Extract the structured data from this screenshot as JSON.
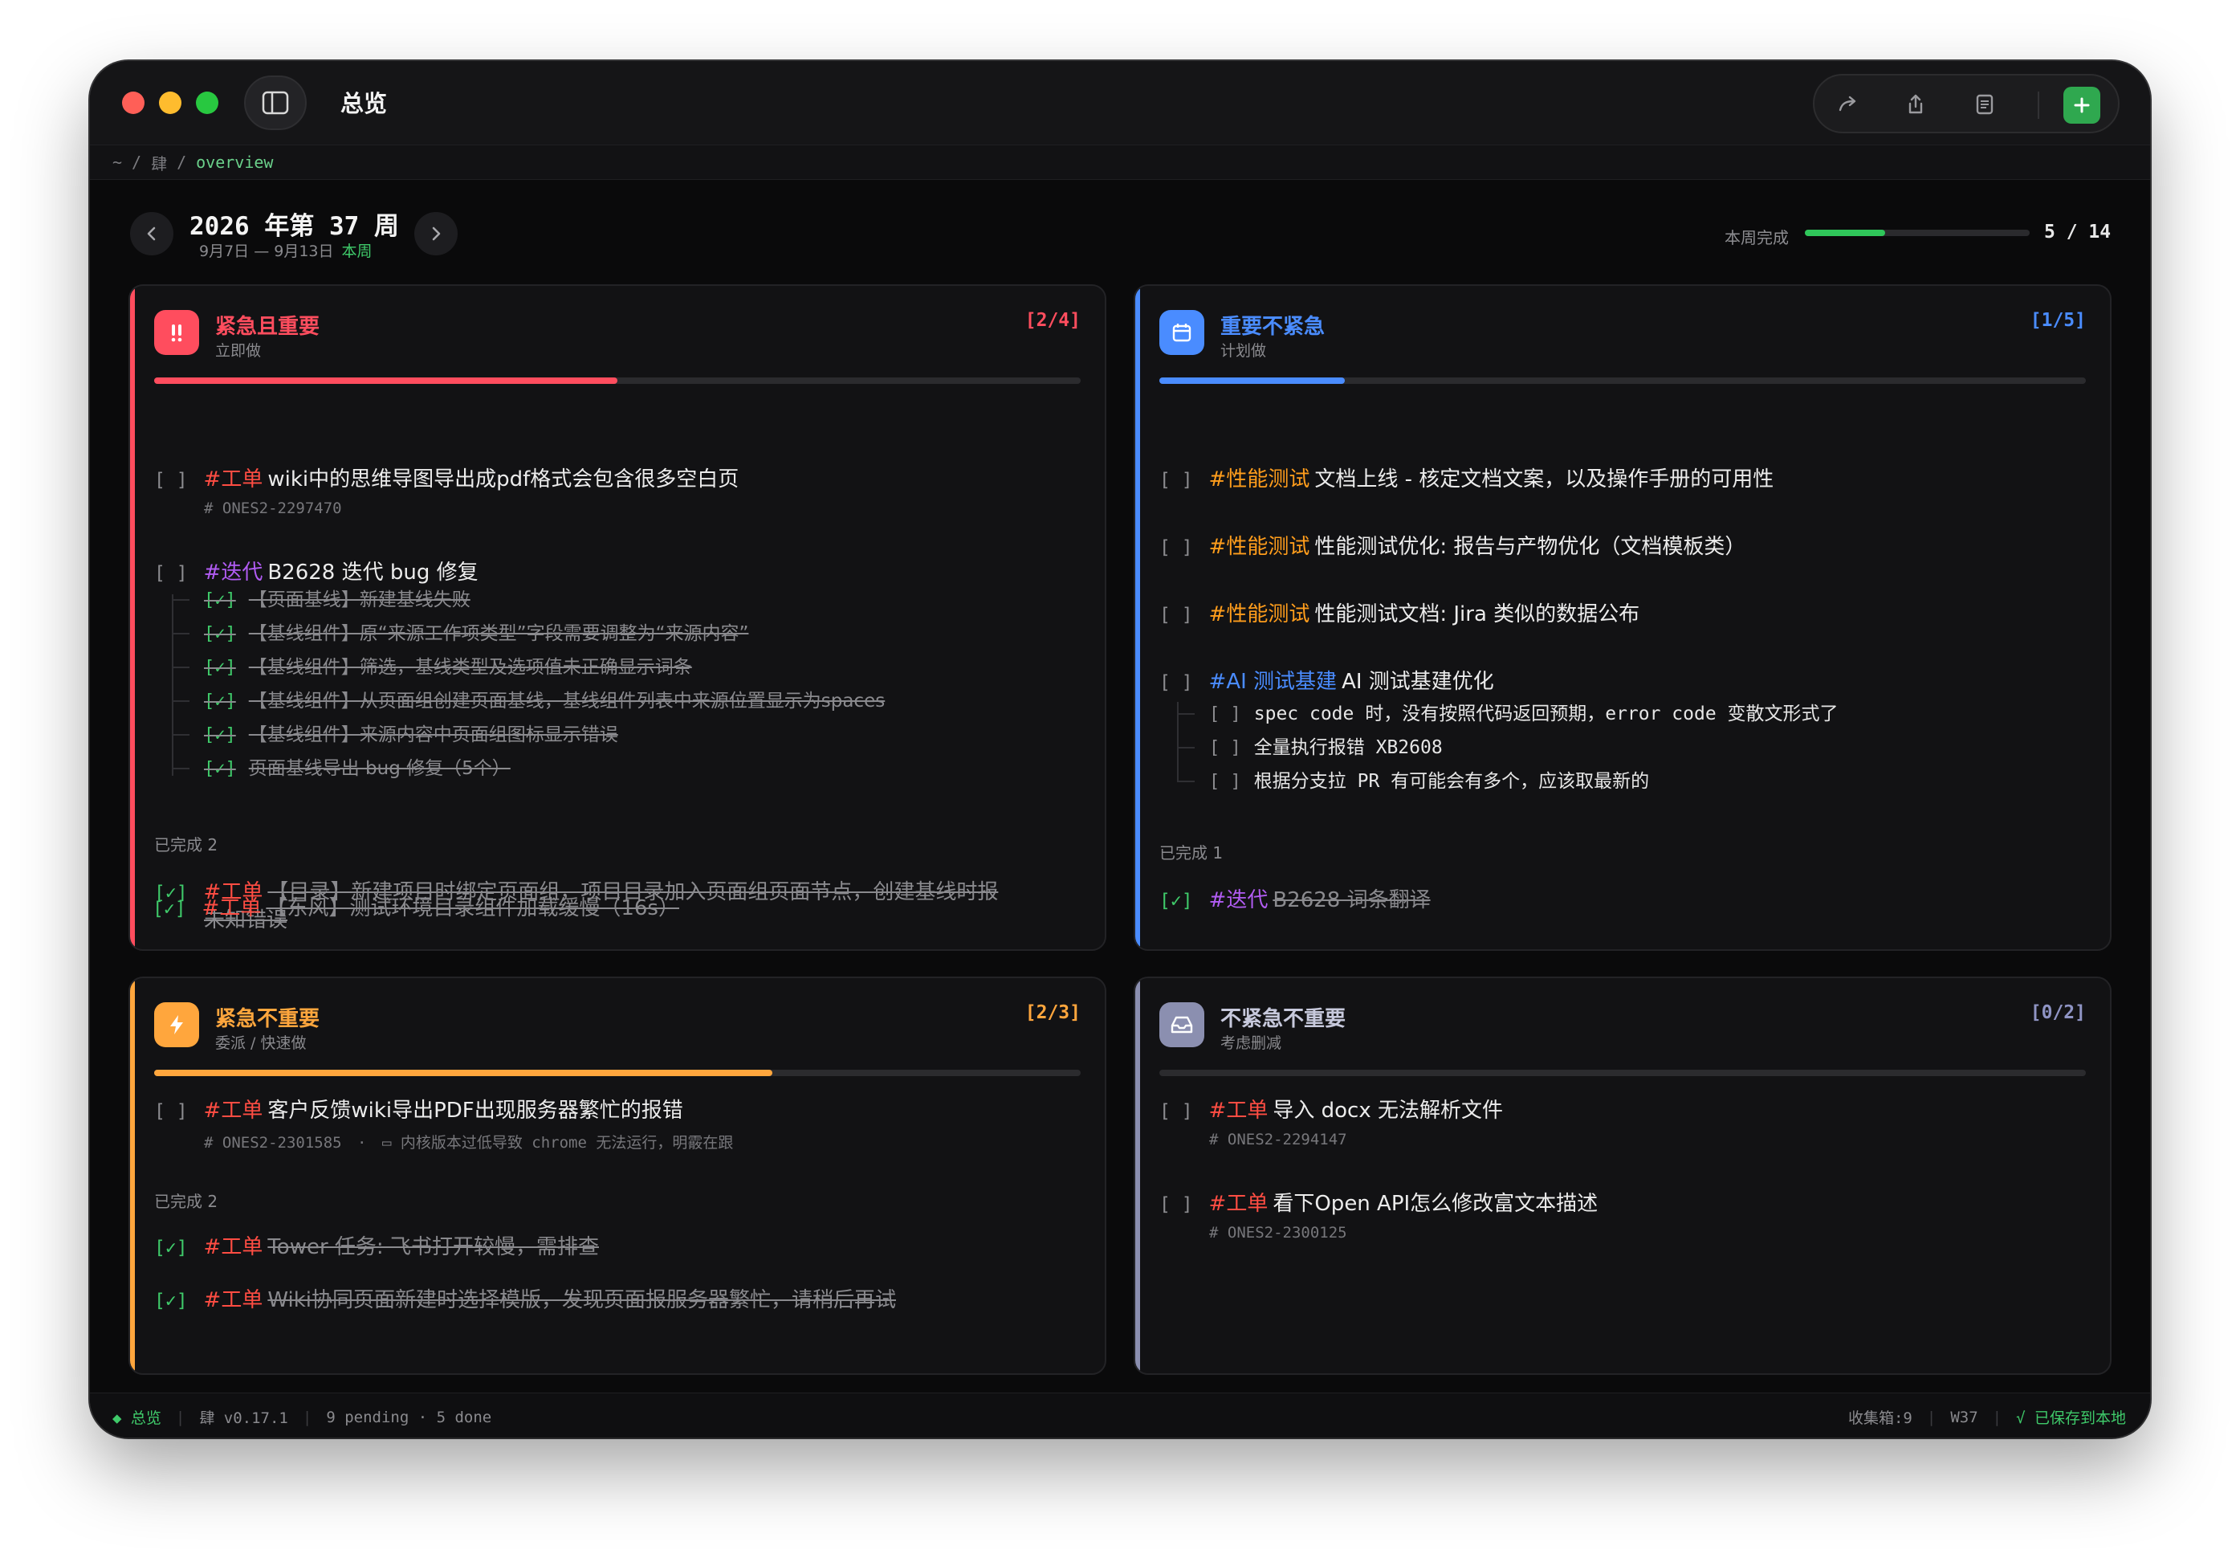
{
  "window": {
    "title": "总览",
    "traffic_lights": [
      "#ff5f57",
      "#febc2e",
      "#28c840"
    ]
  },
  "breadcrumb": {
    "home": "~",
    "sep": "/",
    "workspace": "肆",
    "current": "overview"
  },
  "week": {
    "title": "2026 年第 37 周",
    "range": "9月7日 — 9月13日",
    "tag": "本周",
    "progress_label": "本周完成",
    "progress_done": 5,
    "progress_total": 14,
    "progress_text": "5 / 14"
  },
  "quadrants": {
    "q1": {
      "title": "紧急且重要",
      "subtitle": "立即做",
      "count": "[2/4]",
      "icon": "double-exclamation-icon",
      "color": "#ff4d5e",
      "progress": 0.5,
      "pending": [
        {
          "tag": "#工单",
          "text": "wiki中的思维导图导出成pdf格式会包含很多空白页",
          "meta": "# ONES2-2297470"
        },
        {
          "tag": "#迭代",
          "text": "B2628 迭代 bug 修复",
          "subtasks": [
            "【页面基线】新建基线失败",
            "【基线组件】原“来源工作项类型”字段需要调整为“来源内容”",
            "【基线组件】筛选，基线类型及选项值未正确显示词条",
            "【基线组件】从页面组创建页面基线，基线组件列表中来源位置显示为spaces",
            "【基线组件】来源内容中页面组图标显示错误",
            "页面基线导出 bug 修复（5个）"
          ]
        }
      ],
      "done_label": "已完成 2",
      "done": [
        {
          "tag": "#工单",
          "text": "【目录】新建项目时绑定页面组，项目目录加入页面组页面节点，创建基线时报未知错误"
        },
        {
          "tag": "#工单",
          "text": "【东风】测试环境目录组件加载缓慢（16s）"
        }
      ]
    },
    "q2": {
      "title": "重要不紧急",
      "subtitle": "计划做",
      "count": "[1/5]",
      "icon": "calendar-icon",
      "color": "#4a8cff",
      "progress": 0.2,
      "pending": [
        {
          "tag": "#性能测试",
          "text": "文档上线 - 核定文档文案，以及操作手册的可用性"
        },
        {
          "tag": "#性能测试",
          "text": "性能测试优化: 报告与产物优化（文档模板类）"
        },
        {
          "tag": "#性能测试",
          "text": "性能测试文档: Jira 类似的数据公布"
        },
        {
          "tag": "#AI 测试基建",
          "text": "AI 测试基建优化",
          "subtasks": [
            "spec code 时，没有按照代码返回预期，error code 变散文形式了",
            "全量执行报错 XB2608",
            "根据分支拉 PR 有可能会有多个，应该取最新的"
          ]
        }
      ],
      "done_label": "已完成 1",
      "done": [
        {
          "tag": "#迭代",
          "text": "B2628 词条翻译"
        }
      ]
    },
    "q3": {
      "title": "紧急不重要",
      "subtitle": "委派 / 快速做",
      "count": "[2/3]",
      "icon": "lightning-icon",
      "color": "#ffa63d",
      "progress": 0.667,
      "pending": [
        {
          "tag": "#工单",
          "text": "客户反馈wiki导出PDF出现服务器繁忙的报错",
          "meta": "# ONES2-2301585",
          "comment": "内核版本过低导致 chrome 无法运行，明霰在跟"
        }
      ],
      "done_label": "已完成 2",
      "done": [
        {
          "tag": "#工单",
          "text": "Tower 任务: 飞书打开较慢，需排查"
        },
        {
          "tag": "#工单",
          "text": "Wiki协同页面新建时选择模版，发现页面报服务器繁忙，请稍后再试"
        }
      ]
    },
    "q4": {
      "title": "不紧急不重要",
      "subtitle": "考虑删减",
      "count": "[0/2]",
      "icon": "inbox-icon",
      "color": "#8b8fb0",
      "progress": 0,
      "pending": [
        {
          "tag": "#工单",
          "text": "导入 docx 无法解析文件",
          "meta": "# ONES2-2294147"
        },
        {
          "tag": "#工单",
          "text": "看下Open API怎么修改富文本描述",
          "meta": "# ONES2-2300125"
        }
      ]
    }
  },
  "checkbox": {
    "open": "[ ]",
    "done": "[✓]"
  },
  "statusbar": {
    "view": "总览",
    "app": "肆 v0.17.1",
    "counts": "9 pending · 5 done",
    "inbox": "收集箱:9",
    "week": "W37",
    "saved": "√ 已保存到本地"
  }
}
